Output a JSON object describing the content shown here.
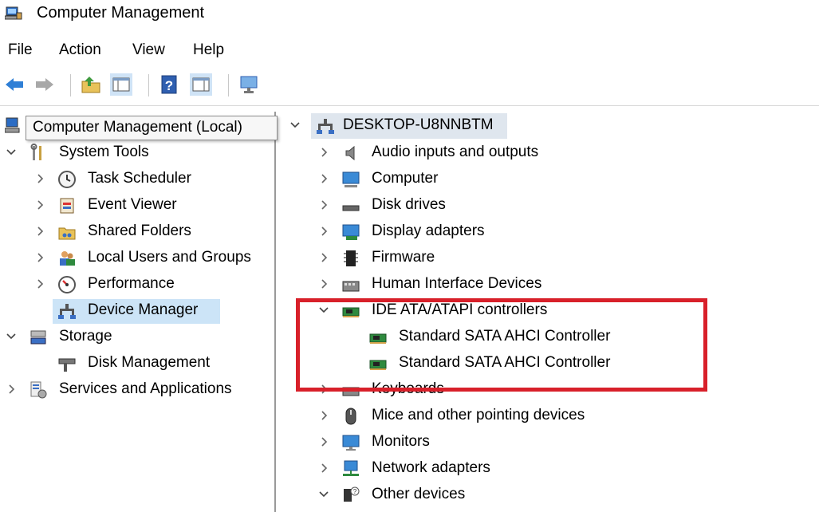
{
  "window": {
    "title": "Computer Management"
  },
  "menu": [
    "File",
    "Action",
    "View",
    "Help"
  ],
  "tooltip": "Computer Management (Local)",
  "left_tree": [
    {
      "label": "System Tools",
      "expanded": true,
      "icon": "tools-icon"
    },
    {
      "label": "Task Scheduler",
      "icon": "clock-icon"
    },
    {
      "label": "Event Viewer",
      "icon": "event-viewer-icon"
    },
    {
      "label": "Shared Folders",
      "icon": "shared-folder-icon"
    },
    {
      "label": "Local Users and Groups",
      "icon": "users-icon"
    },
    {
      "label": "Performance",
      "icon": "performance-icon"
    },
    {
      "label": "Device Manager",
      "icon": "device-manager-icon",
      "selected": true
    },
    {
      "label": "Storage",
      "expanded": true,
      "icon": "storage-icon"
    },
    {
      "label": "Disk Management",
      "icon": "disk-management-icon"
    },
    {
      "label": "Services and Applications",
      "icon": "services-icon"
    }
  ],
  "right_tree": {
    "root": "DESKTOP-U8NNBTM",
    "items": [
      {
        "label": "Audio inputs and outputs",
        "icon": "speaker-icon"
      },
      {
        "label": "Computer",
        "icon": "monitor-icon"
      },
      {
        "label": "Disk drives",
        "icon": "disk-drive-icon"
      },
      {
        "label": "Display adapters",
        "icon": "display-adapter-icon"
      },
      {
        "label": "Firmware",
        "icon": "chip-icon"
      },
      {
        "label": "Human Interface Devices",
        "icon": "hid-icon"
      },
      {
        "label": "IDE ATA/ATAPI controllers",
        "icon": "controller-card-icon",
        "expanded": true
      },
      {
        "label": "Standard SATA AHCI Controller",
        "icon": "controller-card-icon"
      },
      {
        "label": "Standard SATA AHCI Controller",
        "icon": "controller-card-icon"
      },
      {
        "label": "Keyboards",
        "icon": "keyboard-icon"
      },
      {
        "label": "Mice and other pointing devices",
        "icon": "mouse-icon"
      },
      {
        "label": "Monitors",
        "icon": "monitor-icon"
      },
      {
        "label": "Network adapters",
        "icon": "network-icon"
      },
      {
        "label": "Other devices",
        "icon": "unknown-device-icon",
        "expanded": true
      }
    ]
  },
  "colors": {
    "highlight": "#d8202a",
    "selection": "#cce4f7"
  }
}
